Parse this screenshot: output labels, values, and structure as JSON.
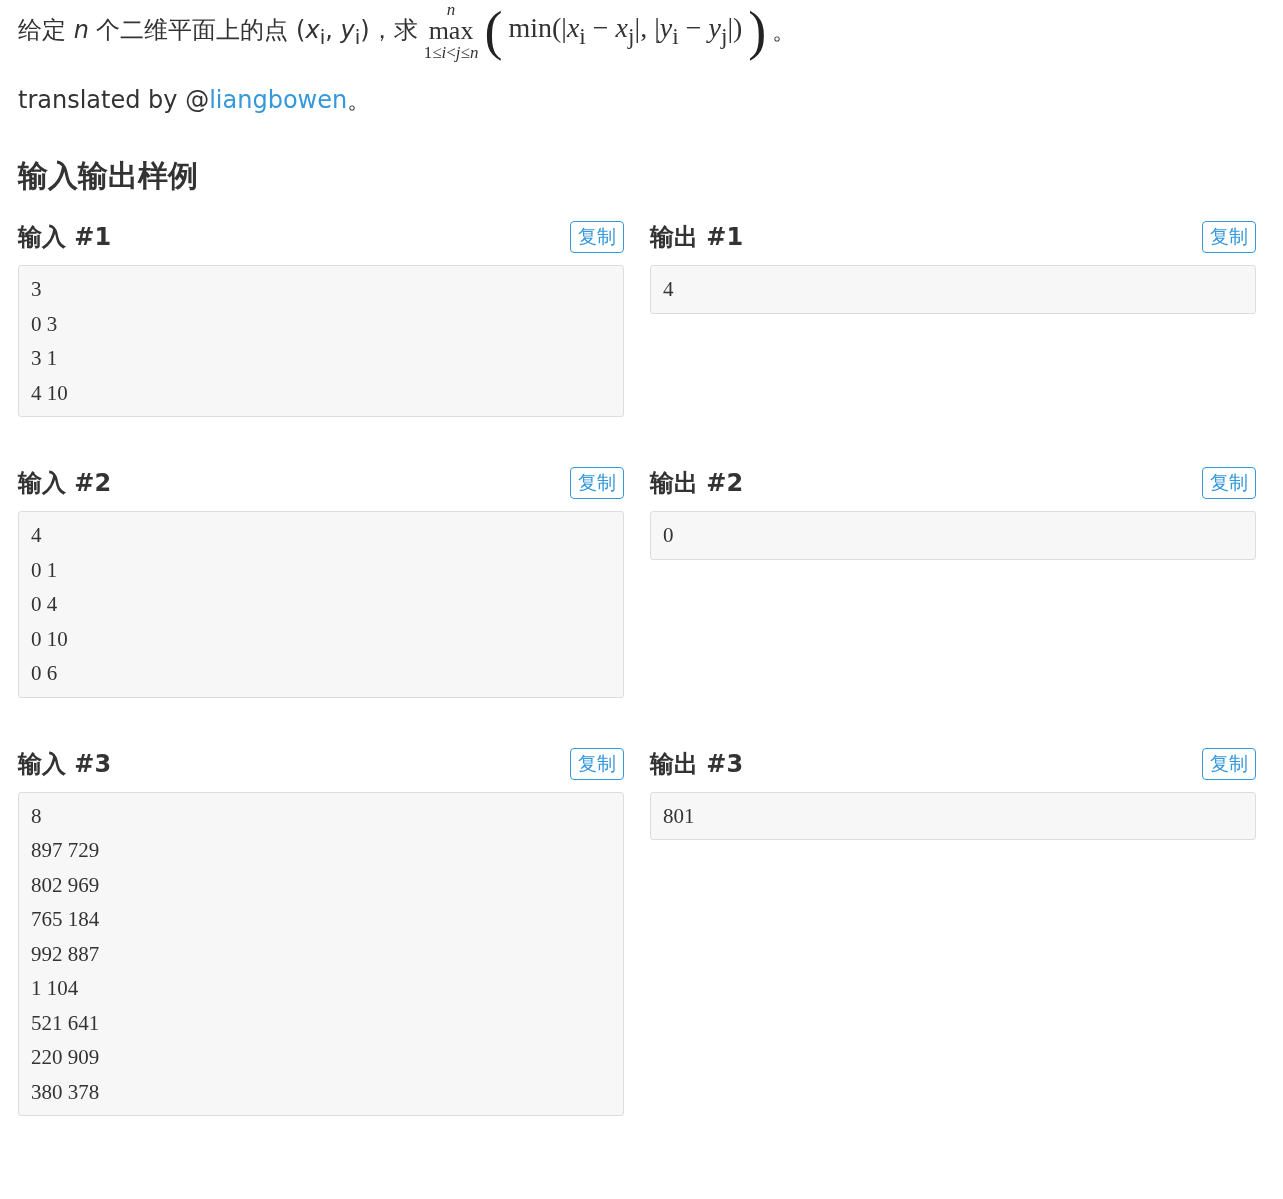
{
  "statement": {
    "text": "给定 *n* 个二维平面上的点 (*x*$_{i}$, *y*$_{i}$)，求",
    "operator": "max",
    "upper": "*n*",
    "lower": "1≤*i*<*j*≤*n*",
    "open": "(",
    "expression": "min(|*x*$_{i}$ − *x*$_{j}$|, |*y*$_{i}$ − *y*$_{j}$|)",
    "close": ")",
    "end": "。"
  },
  "credit": {
    "prefix": "translated by @",
    "link": "liangbowen",
    "suffix": "。"
  },
  "section_title": "输入输出样例",
  "samples": [
    {
      "input_title": "输入 #1",
      "input_copy": "复制",
      "input_lines": [
        "3",
        "0 3",
        "3 1",
        "4 10"
      ],
      "output_title": "输出 #1",
      "output_copy": "复制",
      "output_lines": [
        "4"
      ]
    },
    {
      "input_title": "输入 #2",
      "input_copy": "复制",
      "input_lines": [
        "4",
        "0 1",
        "0 4",
        "0 10",
        "0 6"
      ],
      "output_title": "输出 #2",
      "output_copy": "复制",
      "output_lines": [
        "0"
      ]
    },
    {
      "input_title": "输入 #3",
      "input_copy": "复制",
      "input_lines": [
        "8",
        "897 729",
        "802 969",
        "765 184",
        "992 887",
        "1 104",
        "521 641",
        "220 909",
        "380 378"
      ],
      "output_title": "输出 #3",
      "output_copy": "复制",
      "output_lines": [
        "801"
      ]
    }
  ]
}
